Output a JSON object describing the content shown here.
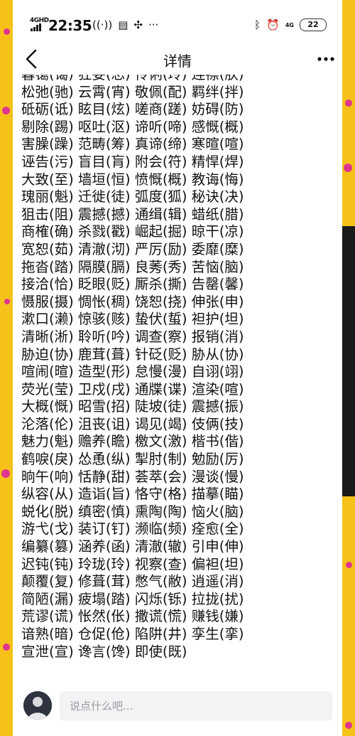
{
  "status_bar": {
    "network": "4GHD",
    "time": "22:35",
    "lte": "4G",
    "battery": "22"
  },
  "nav": {
    "title": "详情"
  },
  "lines": [
    "暮霭(蔼) 狂妄(忘) 伶俐(玲) 连襟(肤)",
    "松弛(驰) 云霄(宵) 敬佩(配) 羁绊(拌)",
    "砥砺(诋) 眩目(炫) 嗟商(蹉) 妨碍(防)",
    "剔除(踢) 呕吐(沤) 谛听(啼) 感慨(概)",
    "害臊(躁) 范畴(筹) 真谛(缔) 寒暄(喧)",
    "诬告(污) 盲目(肓) 附会(符) 精悍(焊)",
    "大致(至) 墙垣(恒) 愤慨(概) 教诲(悔)",
    "瑰丽(魁) 迁徙(徒) 弧度(狐) 秘诀(决)",
    "狙击(阻) 震撼(撼) 通缉(辑) 蜡纸(腊)",
    "商榷(确) 杀戮(戳) 崛起(掘) 晾干(凉)",
    "宽恕(茹) 清澈(沏) 严厉(励) 委靡(糜)",
    "拖沓(踏) 隔膜(膈) 良莠(秀) 苦恼(脑)",
    "接洽(恰) 眨眼(贬) 厮杀(撕) 告罄(馨)",
    "慑服(摄) 惆怅(稠) 饶恕(挠) 伸张(申)",
    "漱口(濑) 惊骇(赅) 蛰伏(蜇) 袒护(坦)",
    "清晰(淅) 聆听(吟) 调查(察) 报销(消)",
    "胁迫(协) 鹿茸(葺) 针砭(贬) 胁从(协)",
    "喧闹(暄) 造型(形) 怠慢(漫) 自诩(翊)",
    "荧光(莹) 卫戍(戌) 通牒(谍) 渲染(喧)",
    "大概(慨) 昭雪(招) 陡坡(徒) 震撼(振)",
    "沦落(伦) 沮丧(诅) 谒见(竭) 伎俩(技)",
    "魅力(魁) 赡养(瞻) 檄文(激) 楷书(偕)",
    "鹤唳(戾) 怂恿(纵) 掣肘(制) 勉励(厉)",
    "晌午(响) 恬静(甜) 荟萃(会) 漫谈(慢)",
    "纵容(从) 造诣(旨) 恪守(格) 描摹(瞄)",
    "蜕化(脱) 缜密(慎) 熏陶(陶) 恼火(脑)",
    "游弋(戈) 装订(钉) 濒临(频) 痊愈(全)",
    "编纂(篡) 涵养(函) 清澈(辙) 引申(伸)",
    "迟钝(钝) 玲珑(玲) 视察(查) 偏袒(坦)",
    "颠覆(复) 修葺(茸) 憋气(敝) 逍遥(消)",
    "简陋(漏) 疲塌(踏) 闪烁(铄) 拉拢(扰)",
    "荒谬(谎) 怅然(伥) 撒谎(慌) 赚钱(嫌)",
    "谙熟(暗) 仓促(伧) 陷阱(井) 孪生(挛)",
    "宣泄(宣) 谗言(馋) 即使(既)"
  ],
  "footer": {
    "comment_placeholder": "说点什么吧..."
  },
  "icons": {
    "back": "chevron-left-icon",
    "more": "more-horizontal-icon",
    "bluetooth": "bluetooth-icon",
    "alarm": "alarm-icon",
    "hotspot": "hotspot-icon",
    "sim": "sim-icon",
    "pinwheel": "pinwheel-icon",
    "dots": "dots-icon"
  },
  "colors": {
    "background": "#f6c21a",
    "dots": "#e0358e",
    "text": "#111111",
    "placeholder": "#9a9aa2"
  }
}
